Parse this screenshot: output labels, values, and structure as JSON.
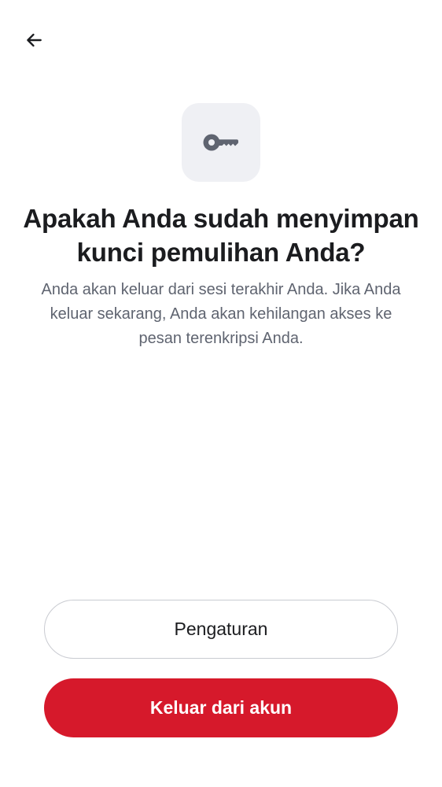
{
  "header": {
    "back_icon": "arrow-left-icon"
  },
  "hero": {
    "icon": "key-icon",
    "icon_color": "#5f6470",
    "tile_color": "#eff0f4"
  },
  "content": {
    "title": "Apakah Anda sudah menyimpan kunci pemulihan Anda?",
    "description": "Anda akan keluar dari sesi terakhir Anda. Jika Anda keluar sekarang, Anda akan kehilangan akses ke pesan terenkripsi Anda."
  },
  "actions": {
    "settings_label": "Pengaturan",
    "logout_label": "Keluar dari akun",
    "logout_color": "#d6192b"
  }
}
